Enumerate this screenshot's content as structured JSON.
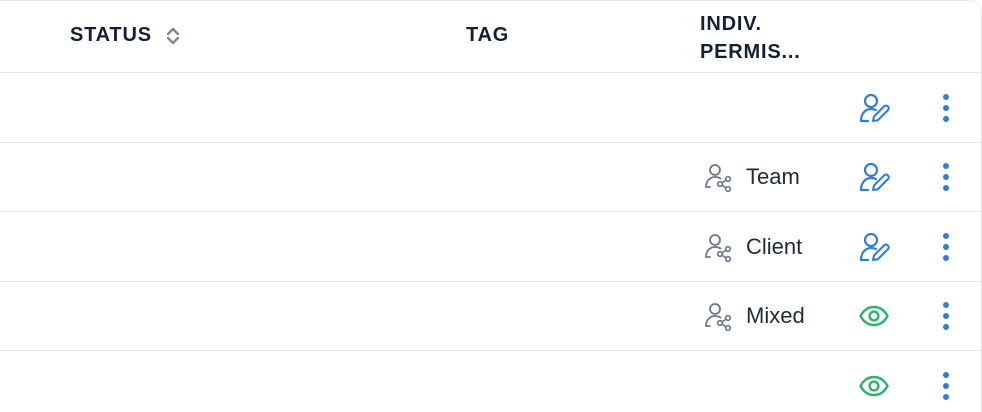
{
  "header": {
    "status_label": "STATUS",
    "tag_label": "TAG",
    "perm_line1": "INDIV.",
    "perm_line2": "PERMIS..."
  },
  "rows": [
    {
      "tag": "",
      "tag_icon": "",
      "permission_icon": "user-edit-icon",
      "menu_icon": "more-vertical-icon"
    },
    {
      "tag": "Team",
      "tag_icon": "users-share-icon",
      "permission_icon": "user-edit-icon",
      "menu_icon": "more-vertical-icon"
    },
    {
      "tag": "Client",
      "tag_icon": "users-share-icon",
      "permission_icon": "user-edit-icon",
      "menu_icon": "more-vertical-icon"
    },
    {
      "tag": "Mixed",
      "tag_icon": "users-share-icon",
      "permission_icon": "eye-icon",
      "menu_icon": "more-vertical-icon"
    },
    {
      "tag": "",
      "tag_icon": "",
      "permission_icon": "eye-icon",
      "menu_icon": "more-vertical-icon"
    }
  ],
  "colors": {
    "edit_icon": "#2f7fd6",
    "view_icon": "#2bb36b",
    "menu_icon": "#2f7fd6",
    "tag_icon": "#6c7789",
    "header_text": "#132034",
    "divider": "#e3e6ea"
  }
}
